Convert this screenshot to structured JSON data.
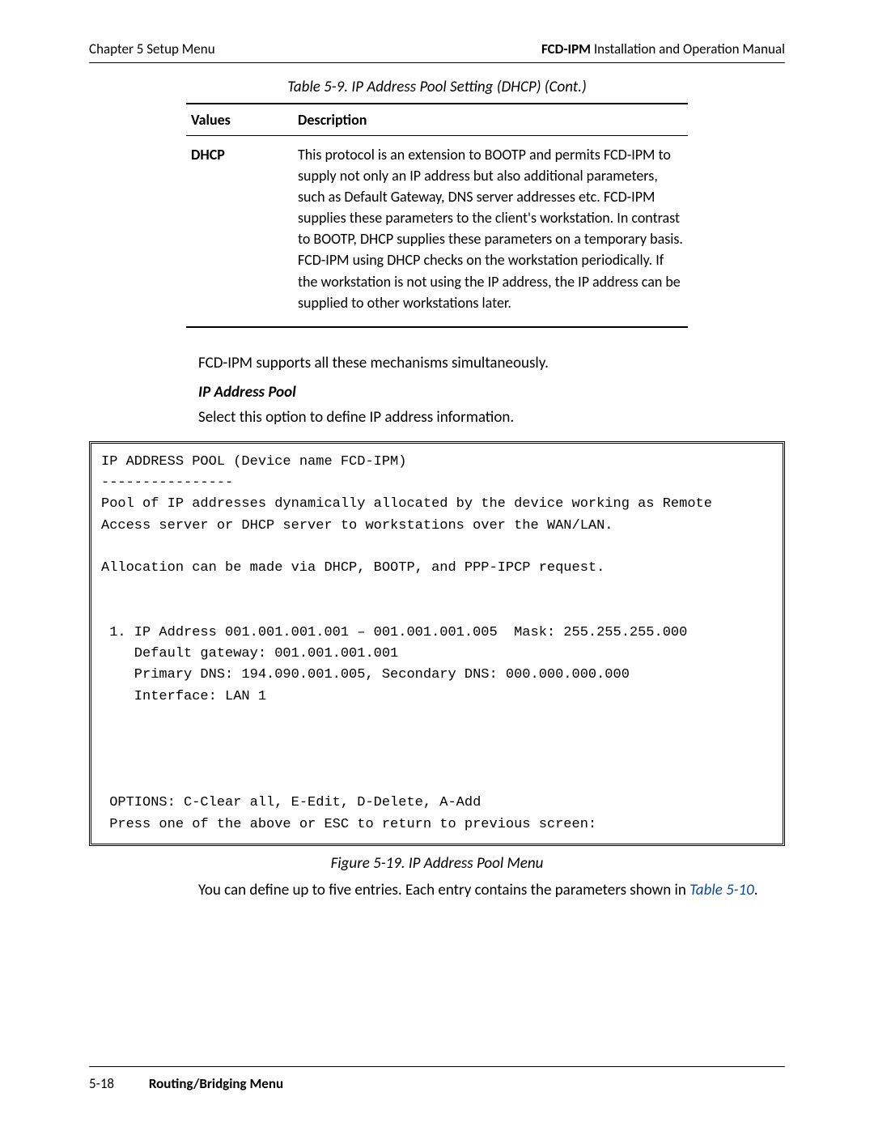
{
  "header": {
    "left": "Chapter 5  Setup Menu",
    "right_bold": "FCD-IPM",
    "right_rest": " Installation and Operation Manual"
  },
  "table_caption": "Table 5-9.  IP Address Pool Setting (DHCP) (Cont.)",
  "table": {
    "head_values": "Values",
    "head_desc": "Description",
    "row_value": "DHCP",
    "row_desc": "This protocol is an extension to BOOTP and permits FCD-IPM to supply not only an IP address but also additional parameters, such as Default Gateway, DNS server addresses etc. FCD-IPM supplies these parameters to the client's workstation. In contrast to BOOTP, DHCP supplies these parameters on a temporary basis. FCD-IPM using DHCP checks on the workstation periodically. If the workstation is not using the IP address, the IP address can be supplied to other workstations later."
  },
  "para1": "FCD-IPM supports all these mechanisms simultaneously.",
  "subhead": "IP Address Pool",
  "para2": "Select this option to define IP address information.",
  "terminal": "IP ADDRESS POOL (Device name FCD-IPM)\n----------------\nPool of IP addresses dynamically allocated by the device working as Remote\nAccess server or DHCP server to workstations over the WAN/LAN.\n\nAllocation can be made via DHCP, BOOTP, and PPP-IPCP request.\n\n\n 1. IP Address 001.001.001.001 – 001.001.001.005  Mask: 255.255.255.000\n    Default gateway: 001.001.001.001\n    Primary DNS: 194.090.001.005, Secondary DNS: 000.000.000.000\n    Interface: LAN 1\n\n\n\n\n OPTIONS: C-Clear all, E-Edit, D-Delete, A-Add\n Press one of the above or ESC to return to previous screen:",
  "figure_caption": "Figure 5-19.  IP Address Pool Menu",
  "para3_a": "You can define up to five entries. Each entry contains the parameters shown in ",
  "para3_link": "Table 5-10",
  "para3_b": ".",
  "footer": {
    "page": "5-18",
    "section": "Routing/Bridging Menu"
  }
}
